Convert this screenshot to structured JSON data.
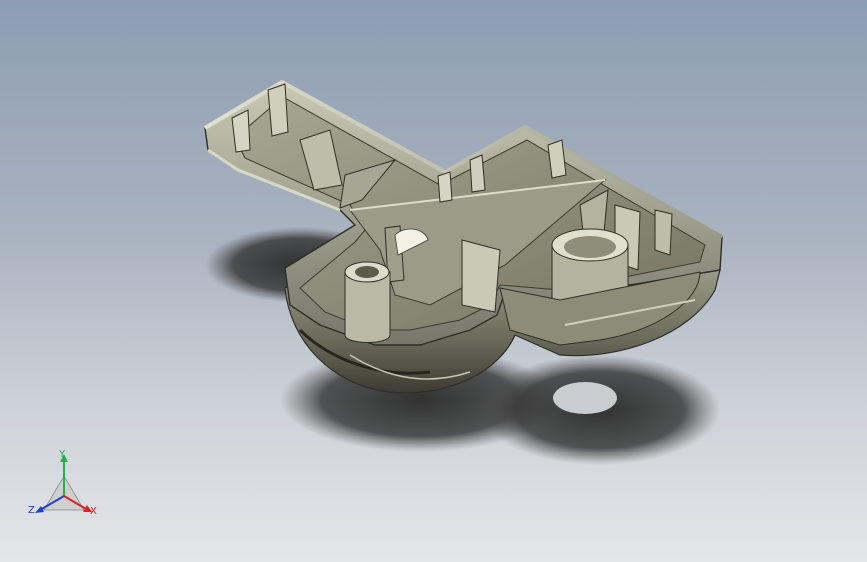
{
  "viewport": {
    "background_top": "#8d9db2",
    "background_bottom": "#e4e6e9",
    "model_color": "#7d7d6d"
  },
  "triad": {
    "y_label": "Y",
    "z_label": "Z",
    "x_label": "X",
    "y_color": "#22b14c",
    "z_color": "#2040d0",
    "x_color": "#e02020"
  }
}
